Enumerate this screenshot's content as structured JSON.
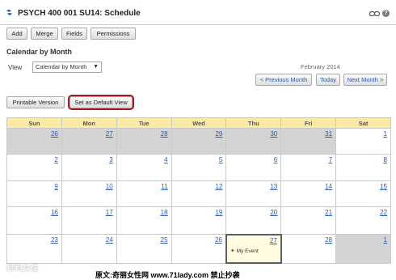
{
  "header": {
    "title": "PSYCH 400 001 SU14: Schedule",
    "help_icon": "?"
  },
  "toolbar": {
    "add_label": "Add",
    "merge_label": "Merge",
    "fields_label": "Fields",
    "permissions_label": "Permissions"
  },
  "section": {
    "title": "Calendar by Month",
    "view_label": "View",
    "view_selected": "Calendar by Month",
    "month_label": "February 2014"
  },
  "nav": {
    "prev_label": "< Previous Month",
    "today_label": "Today",
    "next_label": "Next Month >"
  },
  "actions": {
    "printable_label": "Printable Version",
    "default_label": "Set as Default View"
  },
  "calendar": {
    "weekdays": [
      "Sun",
      "Mon",
      "Tue",
      "Wed",
      "Thu",
      "Fri",
      "Sat"
    ],
    "weeks": [
      [
        {
          "day": "26",
          "other": true
        },
        {
          "day": "27",
          "other": true
        },
        {
          "day": "28",
          "other": true
        },
        {
          "day": "29",
          "other": true
        },
        {
          "day": "30",
          "other": true
        },
        {
          "day": "31",
          "other": true
        },
        {
          "day": "1",
          "other": false
        }
      ],
      [
        {
          "day": "2",
          "other": false
        },
        {
          "day": "3",
          "other": false
        },
        {
          "day": "4",
          "other": false
        },
        {
          "day": "5",
          "other": false
        },
        {
          "day": "6",
          "other": false
        },
        {
          "day": "7",
          "other": false
        },
        {
          "day": "8",
          "other": false
        }
      ],
      [
        {
          "day": "9",
          "other": false
        },
        {
          "day": "10",
          "other": false
        },
        {
          "day": "11",
          "other": false
        },
        {
          "day": "12",
          "other": false
        },
        {
          "day": "13",
          "other": false
        },
        {
          "day": "14",
          "other": false
        },
        {
          "day": "15",
          "other": false
        }
      ],
      [
        {
          "day": "16",
          "other": false
        },
        {
          "day": "17",
          "other": false
        },
        {
          "day": "18",
          "other": false
        },
        {
          "day": "19",
          "other": false
        },
        {
          "day": "20",
          "other": false
        },
        {
          "day": "21",
          "other": false
        },
        {
          "day": "22",
          "other": false
        }
      ],
      [
        {
          "day": "23",
          "other": false
        },
        {
          "day": "24",
          "other": false
        },
        {
          "day": "25",
          "other": false
        },
        {
          "day": "26",
          "other": false
        },
        {
          "day": "27",
          "other": false,
          "today": true,
          "event": "My Event"
        },
        {
          "day": "28",
          "other": false
        },
        {
          "day": "1",
          "other": true
        }
      ]
    ]
  },
  "watermark": {
    "left_text": "利利女性",
    "text": "原文:奇丽女性网 www.71lady.com 禁止抄袭"
  },
  "colors": {
    "header_row": "#fbe9a6",
    "other_month": "#d4d4d4",
    "link": "#2b5aa8",
    "highlight": "#a01c1c"
  }
}
